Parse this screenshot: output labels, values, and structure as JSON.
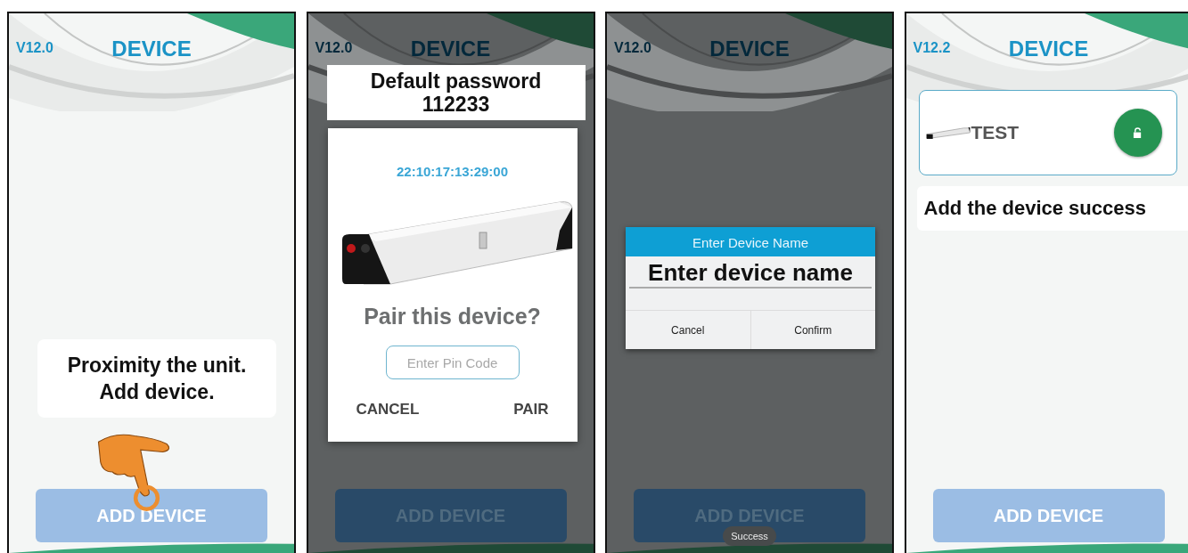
{
  "panels": [
    {
      "kind": "start",
      "dimmed": false,
      "version": "V12.0",
      "title": "DEVICE",
      "button": "ADD DEVICE",
      "callout": [
        "Proximity the unit.",
        "Add device."
      ]
    },
    {
      "kind": "pair",
      "dimmed": true,
      "version": "V12.0",
      "title": "DEVICE",
      "button": "ADD DEVICE",
      "note": [
        "Default password",
        "112233"
      ],
      "dialog": {
        "code": "22:10:17:13:29:00",
        "question": "Pair this device?",
        "placeholder": "Enter Pin Code",
        "buttons": [
          "CANCEL",
          "PAIR"
        ]
      }
    },
    {
      "kind": "name",
      "dimmed": true,
      "version": "V12.0",
      "title": "DEVICE",
      "button": "ADD DEVICE",
      "dialog": {
        "title": "Enter Device Name",
        "value": "Enter device name",
        "buttons": [
          "Cancel",
          "Confirm"
        ]
      },
      "toast": "Success"
    },
    {
      "kind": "done",
      "dimmed": false,
      "version": "V12.2",
      "title": "DEVICE",
      "button": "ADD DEVICE",
      "device": {
        "name": "TEST"
      },
      "note": [
        "Add the device success"
      ]
    }
  ]
}
